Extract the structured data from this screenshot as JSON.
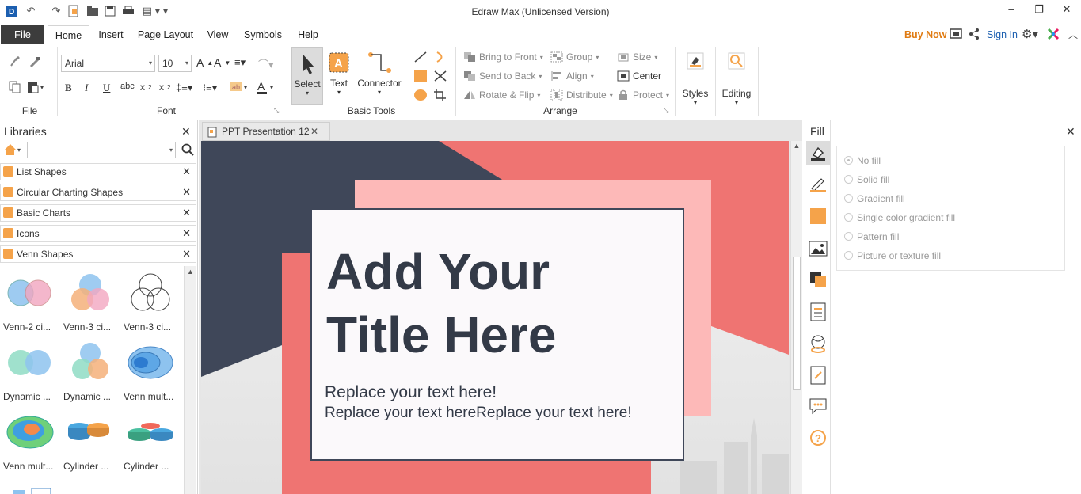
{
  "window": {
    "title": "Edraw Max (Unlicensed Version)"
  },
  "menu": {
    "file": "File",
    "tabs": [
      "Home",
      "Insert",
      "Page Layout",
      "View",
      "Symbols",
      "Help"
    ],
    "buy_now": "Buy Now",
    "sign_in": "Sign In"
  },
  "ribbon": {
    "groups": {
      "file": "File",
      "font": "Font",
      "basic_tools": "Basic Tools",
      "arrange": "Arrange"
    },
    "font_name": "Arial",
    "font_size": "10",
    "select": "Select",
    "text": "Text",
    "connector": "Connector",
    "arrange": {
      "bring_to_front": "Bring to Front",
      "send_to_back": "Send to Back",
      "rotate_flip": "Rotate & Flip",
      "group": "Group",
      "align": "Align",
      "distribute": "Distribute",
      "size": "Size",
      "center": "Center",
      "protect": "Protect"
    },
    "styles": "Styles",
    "editing": "Editing"
  },
  "libraries": {
    "title": "Libraries",
    "search_value": "",
    "categories": [
      "List Shapes",
      "Circular Charting Shapes",
      "Basic Charts",
      "Icons",
      "Venn Shapes"
    ],
    "shapes": [
      "Venn-2 ci...",
      "Venn-3 ci...",
      "Venn-3 ci...",
      "Dynamic ...",
      "Dynamic ...",
      "Venn mult...",
      "Venn mult...",
      "Cylinder ...",
      "Cylinder ..."
    ]
  },
  "document": {
    "tab_label": "PPT Presentation 12"
  },
  "slide": {
    "title_line1": "Add Your",
    "title_line2": "Title Here",
    "body_line1": "Replace your text here!",
    "body_line2": "Replace your text hereReplace your text here!"
  },
  "fill": {
    "title": "Fill",
    "options": [
      "No fill",
      "Solid fill",
      "Gradient fill",
      "Single color gradient fill",
      "Pattern fill",
      "Picture or texture fill"
    ],
    "selected": "No fill"
  },
  "colors": {
    "accent_orange": "#f5a34a",
    "slide_navy": "#3f4759",
    "slide_coral": "#ef7472",
    "slide_pink": "#fdb9b8",
    "brand_blue": "#1c5fb0"
  }
}
